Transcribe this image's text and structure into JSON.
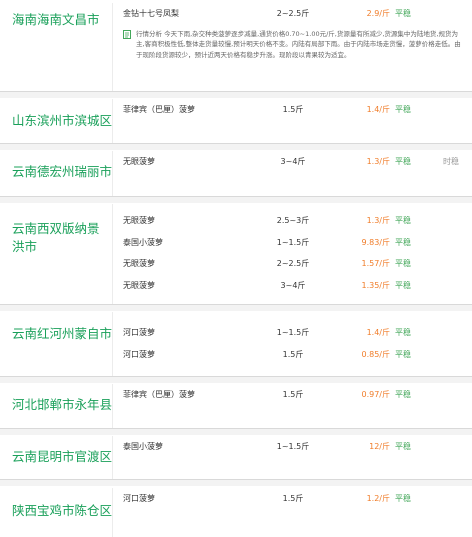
{
  "blocks": [
    {
      "region": "海南海南文昌市",
      "rows": [
        {
          "name": "金钻十七号凤梨",
          "spec": "2~2.5斤",
          "price": "2.9/斤",
          "trend": "平稳"
        }
      ],
      "analysis": "行情分析 今天下雨,杂交种类菠萝逐步减量,通货价格0.70~1.00元/斤,货源量有所减少,货源集中为陆地货,规货为主,客商积极性低,整体走货量较慢,预计明天价格不变。内陆有局部下雨。由于内陆市场走货慢，菠萝价格走低。由于现阶段货源较少，预计近两天价格有稳步升涨。现阶段以青果较为适宜。"
    },
    {
      "region": "山东滨州市滨城区",
      "rows": [
        {
          "name": "菲律宾（巴厘）菠萝",
          "spec": "1.5斤",
          "price": "1.4/斤",
          "trend": "平稳"
        }
      ]
    },
    {
      "region": "云南德宏州瑞丽市",
      "rows": [
        {
          "name": "无眼菠萝",
          "spec": "3~4斤",
          "price": "1.3/斤",
          "trend": "平稳",
          "extra": "时稳"
        }
      ]
    },
    {
      "region": "云南西双版纳景洪市",
      "rows": [
        {
          "name": "无眼菠萝",
          "spec": "2.5~3斤",
          "price": "1.3/斤",
          "trend": "平稳"
        },
        {
          "name": "泰国小菠萝",
          "spec": "1~1.5斤",
          "price": "9.83/斤",
          "trend": "平稳"
        },
        {
          "name": "无眼菠萝",
          "spec": "2~2.5斤",
          "price": "1.57/斤",
          "trend": "平稳"
        },
        {
          "name": "无眼菠萝",
          "spec": "3~4斤",
          "price": "1.35/斤",
          "trend": "平稳"
        }
      ]
    },
    {
      "region": "云南红河州蒙自市",
      "rows": [
        {
          "name": "河口菠萝",
          "spec": "1~1.5斤",
          "price": "1.4/斤",
          "trend": "平稳"
        },
        {
          "name": "河口菠萝",
          "spec": "1.5斤",
          "price": "0.85/斤",
          "trend": "平稳"
        }
      ]
    },
    {
      "region": "河北邯郸市永年县",
      "rows": [
        {
          "name": "菲律宾（巴厘）菠萝",
          "spec": "1.5斤",
          "price": "0.97/斤",
          "trend": "平稳"
        }
      ]
    },
    {
      "region": "云南昆明市官渡区",
      "rows": [
        {
          "name": "泰国小菠萝",
          "spec": "1~1.5斤",
          "price": "12/斤",
          "trend": "平稳"
        }
      ]
    },
    {
      "region": "陕西宝鸡市陈仓区",
      "rows": [
        {
          "name": "河口菠萝",
          "spec": "1.5斤",
          "price": "1.2/斤",
          "trend": "平稳"
        }
      ]
    }
  ],
  "colors": {
    "region": "#1aa05a",
    "price": "#f07d2a",
    "trend": "#43a75a"
  },
  "icons": {
    "analysis": "document-icon"
  }
}
